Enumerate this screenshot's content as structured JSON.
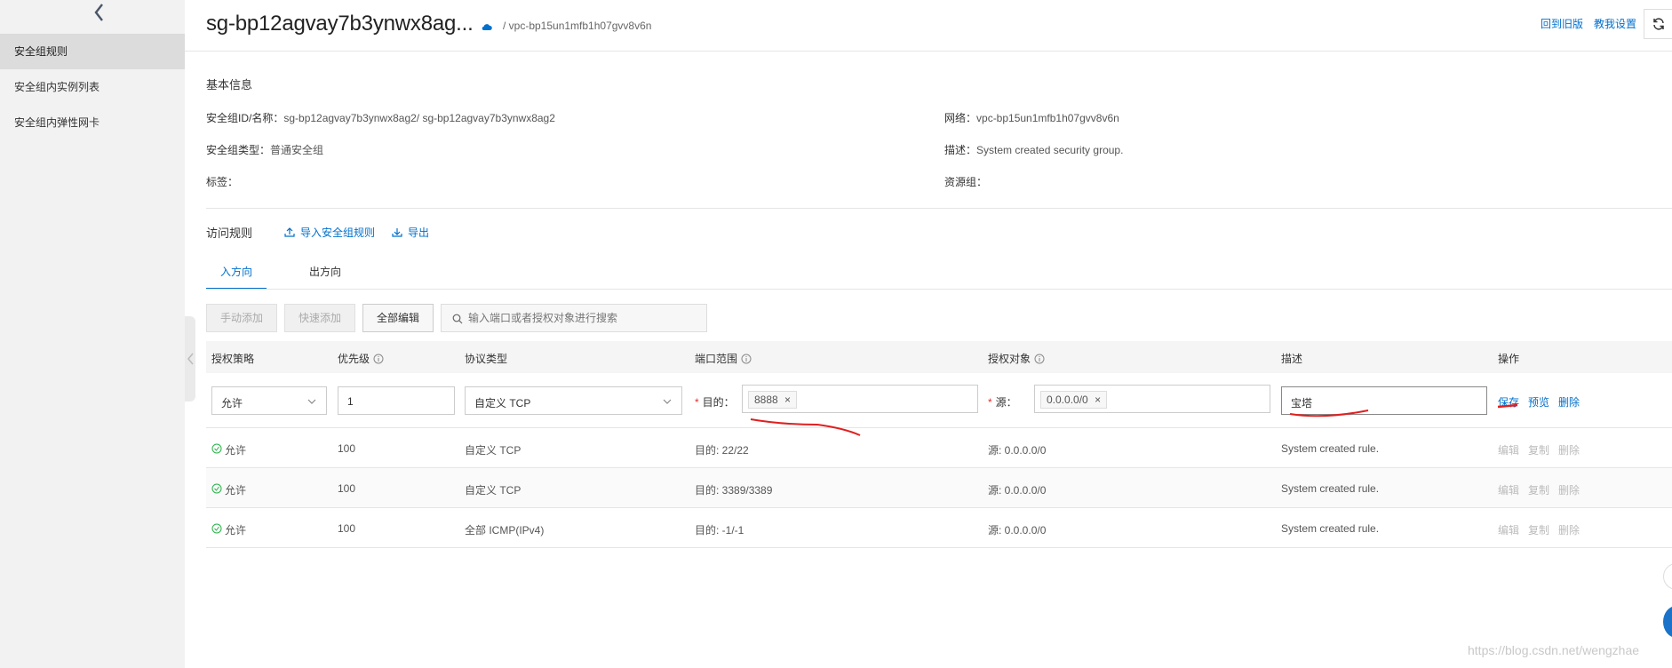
{
  "sidebar": {
    "items": [
      {
        "label": "安全组规则",
        "active": true
      },
      {
        "label": "安全组内实例列表",
        "active": false
      },
      {
        "label": "安全组内弹性网卡",
        "active": false
      }
    ]
  },
  "header": {
    "title": "sg-bp12agvay7b3ynwx8ag...",
    "breadcrumb": "/ vpc-bp15un1mfb1h07gvv8v6n",
    "links": [
      "回到旧版",
      "教我设置"
    ]
  },
  "basic_info": {
    "title": "基本信息",
    "id_label": "安全组ID/名称：",
    "id_value": "sg-bp12agvay7b3ynwx8ag2/ sg-bp12agvay7b3ynwx8ag2",
    "type_label": "安全组类型：",
    "type_value": "普通安全组",
    "tags_label": "标签：",
    "network_label": "网络：",
    "network_value": "vpc-bp15un1mfb1h07gvv8v6n",
    "desc_label": "描述：",
    "desc_value": "System created security group.",
    "rg_label": "资源组："
  },
  "access_rules": {
    "title": "访问规则",
    "import_label": "导入安全组规则",
    "export_label": "导出"
  },
  "tabs": [
    "入方向",
    "出方向"
  ],
  "toolbar": {
    "manual_add": "手动添加",
    "quick_add": "快速添加",
    "edit_all": "全部编辑",
    "search_placeholder": "输入端口或者授权对象进行搜索"
  },
  "table": {
    "headers": [
      "授权策略",
      "优先级",
      "协议类型",
      "端口范围",
      "授权对象",
      "描述",
      "操作"
    ],
    "edit_row": {
      "policy": "允许",
      "priority": "1",
      "protocol": "自定义 TCP",
      "dest_label": "目的：",
      "dest_tag": "8888",
      "source_label": "源：",
      "source_tag": "0.0.0.0/0",
      "description": "宝塔",
      "ops": [
        "保存",
        "预览",
        "删除"
      ]
    },
    "rows": [
      {
        "policy": "允许",
        "priority": "100",
        "protocol": "自定义 TCP",
        "port": "目的: 22/22",
        "source": "源: 0.0.0.0/0",
        "desc": "System created rule."
      },
      {
        "policy": "允许",
        "priority": "100",
        "protocol": "自定义 TCP",
        "port": "目的: 3389/3389",
        "source": "源: 0.0.0.0/0",
        "desc": "System created rule."
      },
      {
        "policy": "允许",
        "priority": "100",
        "protocol": "全部 ICMP(IPv4)",
        "port": "目的: -1/-1",
        "source": "源: 0.0.0.0/0",
        "desc": "System created rule."
      }
    ],
    "row_ops": [
      "编辑",
      "复制",
      "删除"
    ]
  },
  "watermark": "https://blog.csdn.net/wengzhae",
  "colors": {
    "accent": "#0070cc",
    "success": "#2ab04a",
    "annotation": "#e02020"
  }
}
